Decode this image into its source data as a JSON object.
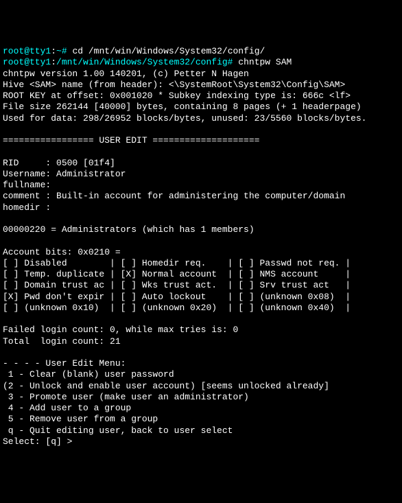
{
  "prompt1": {
    "user": "root@tty1",
    "path": "~",
    "sep": "#",
    "cmd": "cd /mnt/win/Windows/System32/config/"
  },
  "prompt2": {
    "user": "root@tty1",
    "path": "/mnt/win/Windows/System32/config",
    "sep": "#",
    "cmd": "chntpw SAM"
  },
  "out": {
    "version": "chntpw version 1.00 140201, (c) Petter N Hagen",
    "hive": "Hive <SAM> name (from header): <\\SystemRoot\\System32\\Config\\SAM>",
    "rootkey": "ROOT KEY at offset: 0x001020 * Subkey indexing type is: 666c <lf>",
    "filesize": "File size 262144 [40000] bytes, containing 8 pages (+ 1 headerpage)",
    "used": "Used for data: 298/26952 blocks/bytes, unused: 23/5560 blocks/bytes."
  },
  "section": "================= USER EDIT ====================",
  "user": {
    "rid": "RID     : 0500 [01f4]",
    "username": "Username: Administrator",
    "fullname": "fullname:",
    "comment": "comment : Built-in account for administering the computer/domain",
    "homedir": "homedir :"
  },
  "group": "00000220 = Administrators (which has 1 members)",
  "bits": {
    "header": "Account bits: 0x0210 =",
    "r1": "[ ] Disabled        | [ ] Homedir req.    | [ ] Passwd not req. |",
    "r2": "[ ] Temp. duplicate | [X] Normal account  | [ ] NMS account     |",
    "r3": "[ ] Domain trust ac | [ ] Wks trust act.  | [ ] Srv trust act   |",
    "r4": "[X] Pwd don't expir | [ ] Auto lockout    | [ ] (unknown 0x08)  |",
    "r5": "[ ] (unknown 0x10)  | [ ] (unknown 0x20)  | [ ] (unknown 0x40)  |"
  },
  "login": {
    "failed": "Failed login count: 0, while max tries is: 0",
    "total": "Total  login count: 21"
  },
  "menu": {
    "header": "- - - - User Edit Menu:",
    "m1": " 1 - Clear (blank) user password",
    "m2": "(2 - Unlock and enable user account) [seems unlocked already]",
    "m3": " 3 - Promote user (make user an administrator)",
    "m4": " 4 - Add user to a group",
    "m5": " 5 - Remove user from a group",
    "mq": " q - Quit editing user, back to user select",
    "prompt": "Select: [q] > "
  }
}
